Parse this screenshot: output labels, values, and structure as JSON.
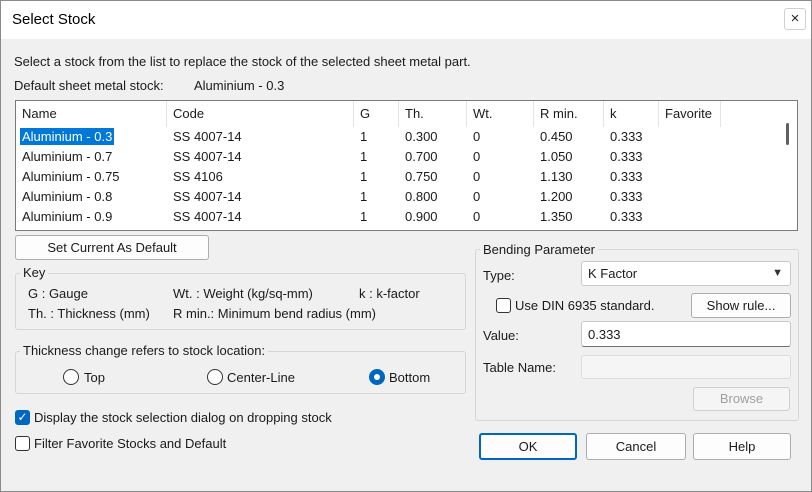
{
  "window": {
    "title": "Select Stock",
    "close_glyph": "×"
  },
  "intro_text": "Select a stock from the list to replace the stock of the selected sheet metal part.",
  "default_stock": {
    "label": "Default sheet metal stock:",
    "value": "Aluminium - 0.3"
  },
  "table": {
    "columns": [
      "Name",
      "Code",
      "G",
      "Th.",
      "Wt.",
      "R min.",
      "k",
      "Favorite"
    ],
    "rows": [
      [
        "Aluminium - 0.3",
        "SS 4007-14",
        "1",
        "0.300",
        "0",
        "0.450",
        "0.333",
        ""
      ],
      [
        "Aluminium - 0.7",
        "SS 4007-14",
        "1",
        "0.700",
        "0",
        "1.050",
        "0.333",
        ""
      ],
      [
        "Aluminium - 0.75",
        "SS 4106",
        "1",
        "0.750",
        "0",
        "1.130",
        "0.333",
        ""
      ],
      [
        "Aluminium - 0.8",
        "SS 4007-14",
        "1",
        "0.800",
        "0",
        "1.200",
        "0.333",
        ""
      ],
      [
        "Aluminium - 0.9",
        "SS 4007-14",
        "1",
        "0.900",
        "0",
        "1.350",
        "0.333",
        ""
      ]
    ],
    "selected_row": 0
  },
  "buttons": {
    "set_default": "Set Current As Default",
    "show_rule": "Show rule...",
    "browse": "Browse",
    "ok": "OK",
    "cancel": "Cancel",
    "help": "Help"
  },
  "key": {
    "title": "Key",
    "gauge": "G : Gauge",
    "weight": "Wt. : Weight (kg/sq-mm)",
    "kfactor": "k : k-factor",
    "thickness": "Th. : Thickness (mm)",
    "rmin": "R min.: Minimum bend radius (mm)"
  },
  "thickness_change": {
    "title": "Thickness change refers to stock location:",
    "options": [
      "Top",
      "Center-Line",
      "Bottom"
    ],
    "selected": "Bottom"
  },
  "bending": {
    "title": "Bending Parameter",
    "type_label": "Type:",
    "type_value": "K Factor",
    "din_label": "Use DIN 6935 standard.",
    "din_checked": false,
    "value_label": "Value:",
    "value": "0.333",
    "table_name_label": "Table Name:",
    "table_name": ""
  },
  "checkboxes": {
    "display_dialog": {
      "label": "Display the stock selection dialog on dropping stock",
      "checked": true
    },
    "filter_favorites": {
      "label": "Filter Favorite Stocks and Default",
      "checked": false
    }
  },
  "icons": {
    "close": "close-icon",
    "dropdown": "chevron-down-icon",
    "check": "checkmark-icon"
  },
  "colors": {
    "accent": "#0067c0",
    "selection": "#0078d7"
  }
}
